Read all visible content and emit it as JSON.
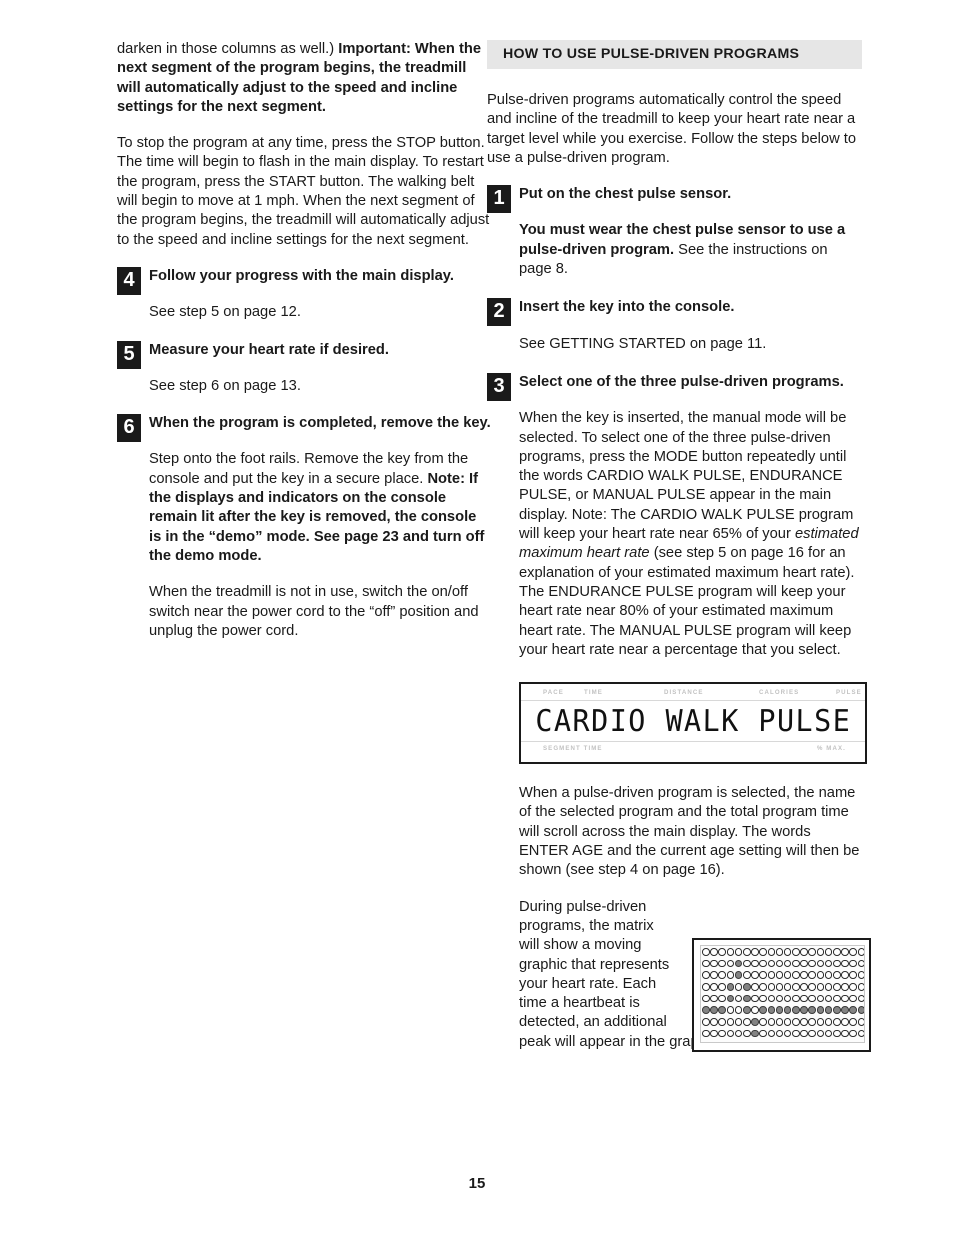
{
  "document": {
    "page_number": "15"
  },
  "left_column": {
    "para_1_lead": "darken in those columns as well.) ",
    "para_1_bold": "Important: When the next segment of the program begins, the treadmill will automatically adjust to the speed and incline settings for the next segment.",
    "para_2": "To stop the program at any time, press the STOP button. The time will begin to flash in the main display. To restart the program, press the START button. The walking belt will begin to move at 1 mph. When the next segment of the program begins, the treadmill will automatically adjust to the speed and incline settings for the next segment.",
    "steps": [
      {
        "number": "4",
        "heading": "Follow your progress with the main display.",
        "body": "See step 5 on page 12."
      },
      {
        "number": "5",
        "heading": "Measure your heart rate if desired.",
        "body": "See step 6 on page 13."
      },
      {
        "number": "6",
        "heading": "When the program is completed, remove the key.",
        "body_lead": "Step onto the foot rails. Remove the key from the console and put the key in a secure place. ",
        "body_bold": "Note: If the displays and indicators on the console remain lit after the key is removed, the console is in the “demo” mode. See page 23 and turn off the demo mode.",
        "body_2": "When the treadmill is not in use, switch the on/off switch near the power cord to the “off” position and unplug the power cord."
      }
    ]
  },
  "right_column": {
    "section_heading": "HOW TO USE PULSE-DRIVEN PROGRAMS",
    "intro": "Pulse-driven programs automatically control the speed and incline of the treadmill to keep your heart rate near a target level while you exercise. Follow the steps below to use a pulse-driven program.",
    "steps": [
      {
        "number": "1",
        "heading": "Put on the chest pulse sensor.",
        "body_bold": "You must wear the chest pulse sensor to use a pulse-driven program.",
        "body_rest": " See the instructions on page 8."
      },
      {
        "number": "2",
        "heading": "Insert the key into the console.",
        "body": "See GETTING STARTED on page 11."
      },
      {
        "number": "3",
        "heading": "Select one of the three pulse-driven programs.",
        "body_part_1": "When the key is inserted, the manual mode will be selected. To select one of the three pulse-driven programs, press the MODE button repeatedly until the words CARDIO WALK PULSE, ENDURANCE PULSE, or MANUAL PULSE appear in the main display. Note: The CARDIO WALK PULSE program will keep your heart rate near 65% of your ",
        "body_italic": "estimated maximum heart rate",
        "body_part_2": " (see step 5 on page 16 for an explanation of your estimated maximum heart rate). The ENDURANCE PULSE program will keep your heart rate near 80% of your estimated maximum heart rate. The MANUAL PULSE program will keep your heart rate near a percentage that you select."
      }
    ],
    "after_console_para": "When a pulse-driven program is selected, the name of the selected program and the total program time will scroll across the main display. The words ENTER AGE and the current age setting will then be shown (see step 4 on page 16).",
    "matrix_para": "During pulse-driven programs, the matrix will show a moving graphic that represents your heart rate. Each time a heartbeat is detected, an additional peak will appear in the graphic."
  },
  "console_display": {
    "labels": {
      "pace": "PACE",
      "time": "TIME",
      "distance": "DISTANCE",
      "calories": "CALORIES",
      "pulse": "PULSE",
      "segment_time": "SEGMENT TIME",
      "pct_max": "% MAX."
    },
    "main_text": "CARDIO WALK PULSE"
  },
  "matrix_graphic": {
    "rows": 8,
    "cols": 20,
    "on_color": "#838383",
    "off_color": "#ffffff",
    "pattern": [
      [
        0,
        0,
        0,
        0,
        0,
        0,
        0,
        0,
        0,
        0,
        0,
        0,
        0,
        0,
        0,
        0,
        0,
        0,
        0,
        0
      ],
      [
        0,
        0,
        0,
        0,
        1,
        0,
        0,
        0,
        0,
        0,
        0,
        0,
        0,
        0,
        0,
        0,
        0,
        0,
        0,
        0
      ],
      [
        0,
        0,
        0,
        0,
        1,
        0,
        0,
        0,
        0,
        0,
        0,
        0,
        0,
        0,
        0,
        0,
        0,
        0,
        0,
        0
      ],
      [
        0,
        0,
        0,
        1,
        0,
        1,
        0,
        0,
        0,
        0,
        0,
        0,
        0,
        0,
        0,
        0,
        0,
        0,
        0,
        0
      ],
      [
        0,
        0,
        0,
        1,
        0,
        1,
        0,
        0,
        0,
        0,
        0,
        0,
        0,
        0,
        0,
        0,
        0,
        0,
        0,
        0
      ],
      [
        1,
        1,
        1,
        0,
        0,
        1,
        0,
        1,
        1,
        1,
        1,
        1,
        1,
        1,
        1,
        1,
        1,
        1,
        1,
        1
      ],
      [
        0,
        0,
        0,
        0,
        0,
        0,
        1,
        0,
        0,
        0,
        0,
        0,
        0,
        0,
        0,
        0,
        0,
        0,
        0,
        0
      ],
      [
        0,
        0,
        0,
        0,
        0,
        0,
        1,
        0,
        0,
        0,
        0,
        0,
        0,
        0,
        0,
        0,
        0,
        0,
        0,
        0
      ]
    ]
  }
}
